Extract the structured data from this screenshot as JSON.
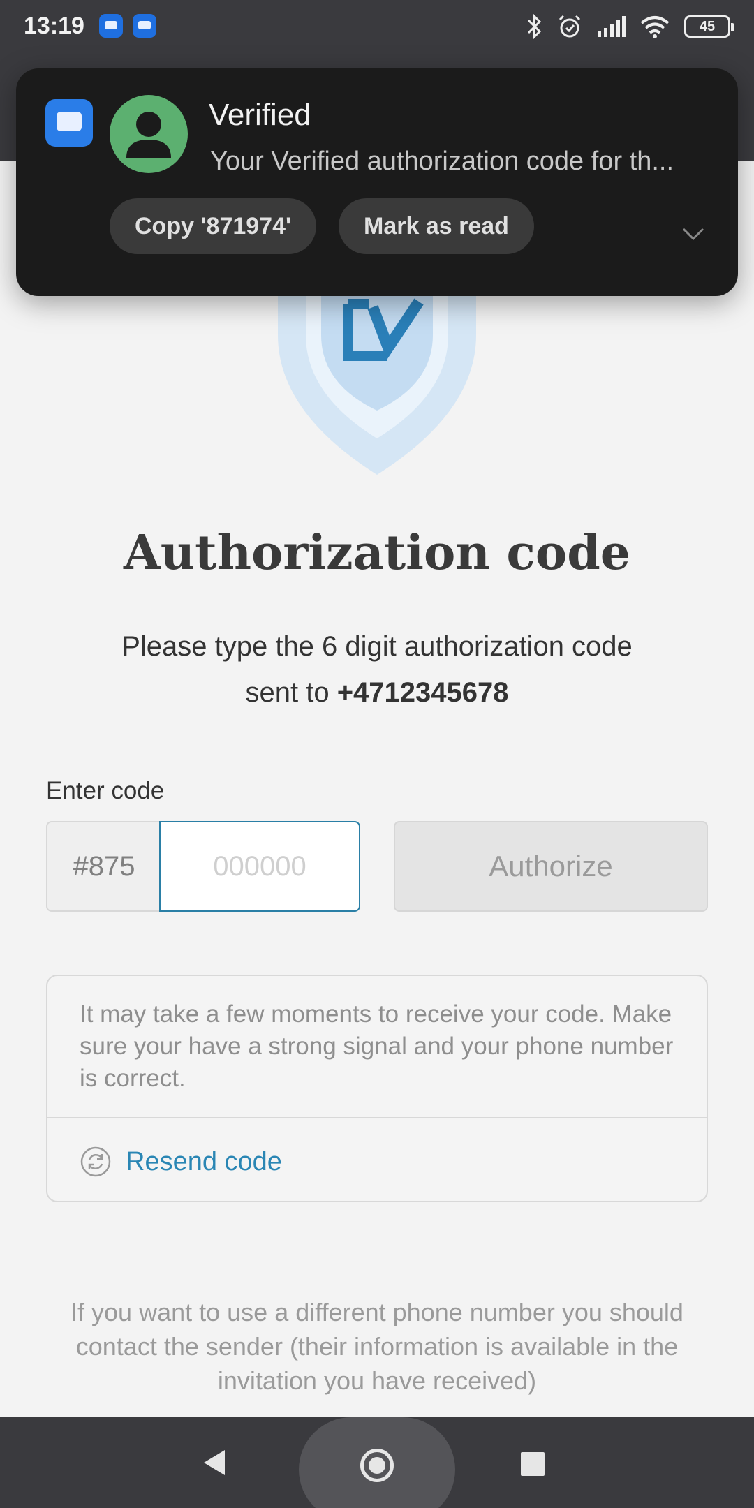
{
  "status_bar": {
    "time": "13:19",
    "battery": "45",
    "icons": [
      "messages-icon",
      "messages-icon",
      "bluetooth-icon",
      "alarm-icon",
      "signal-icon",
      "wifi-icon",
      "battery-icon"
    ]
  },
  "notification": {
    "sender": "Verified",
    "body": "Your Verified authorization code for th...",
    "actions": {
      "copy": "Copy '871974'",
      "mark_read": "Mark as read"
    }
  },
  "main": {
    "title": "Authorization code",
    "instructions_line1": "Please type the 6 digit authorization code",
    "instructions_prefix": "sent to",
    "phone_number": "+4712345678",
    "enter_code_label": "Enter code",
    "code_prefix": "#875",
    "code_placeholder": "000000",
    "authorize_label": "Authorize",
    "info_text": "It may take a few moments to receive your code. Make sure your have a strong signal and your phone number is correct.",
    "resend_label": "Resend code",
    "footer_note": "If you want to use a different phone number you should contact the sender (their information is available in the invitation you have received)"
  },
  "colors": {
    "accent": "#2a86b4",
    "notification_bg": "#1b1b1b",
    "avatar_green": "#5cb070"
  }
}
